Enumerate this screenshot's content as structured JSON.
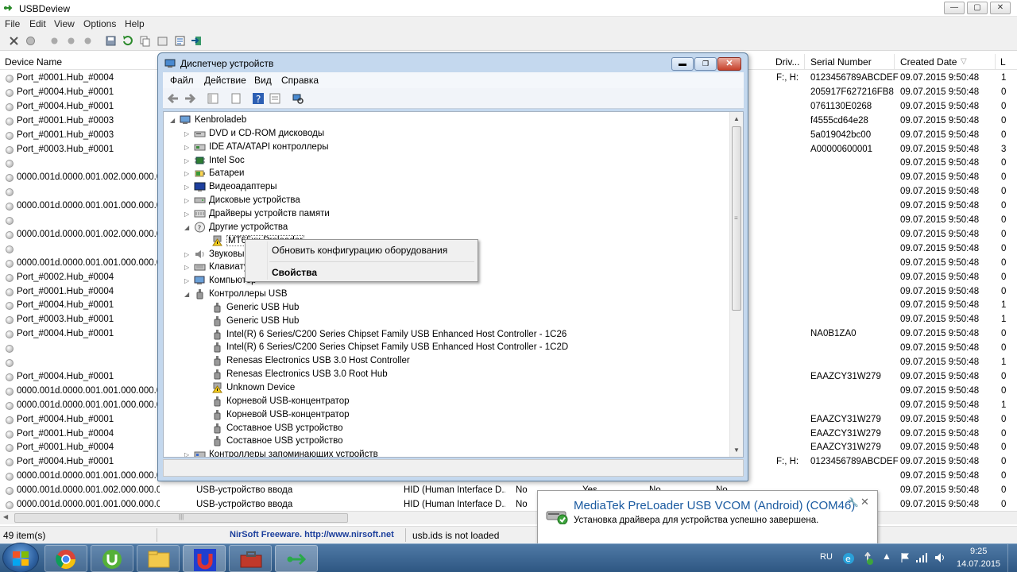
{
  "usbdeview": {
    "title": "USBDeview",
    "menu": [
      "File",
      "Edit",
      "View",
      "Options",
      "Help"
    ],
    "columns": {
      "device_name": "Device Name",
      "drive": "Driv...",
      "serial": "Serial Number",
      "created": "Created Date",
      "last": "L"
    },
    "rows": [
      [
        "Port_#0001.Hub_#0004",
        "",
        "",
        "",
        "",
        "",
        "",
        "F:, H:",
        "0123456789ABCDEF",
        "09.07.2015 9:50:48",
        "1"
      ],
      [
        "Port_#0004.Hub_#0001",
        "",
        "",
        "",
        "",
        "",
        "",
        "",
        "205917F627216FB8",
        "09.07.2015 9:50:48",
        "0"
      ],
      [
        "Port_#0004.Hub_#0001",
        "",
        "",
        "",
        "",
        "",
        "",
        "",
        "0761130E0268",
        "09.07.2015 9:50:48",
        "0"
      ],
      [
        "Port_#0001.Hub_#0003",
        "",
        "",
        "",
        "",
        "",
        "",
        "",
        "f4555cd64e28",
        "09.07.2015 9:50:48",
        "0"
      ],
      [
        "Port_#0001.Hub_#0003",
        "",
        "",
        "",
        "",
        "",
        "",
        "",
        "5a019042bc00",
        "09.07.2015 9:50:48",
        "0"
      ],
      [
        "Port_#0003.Hub_#0001",
        "",
        "",
        "",
        "",
        "",
        "",
        "",
        "A00000600001",
        "09.07.2015 9:50:48",
        "3"
      ],
      [
        "",
        "",
        "",
        "",
        "",
        "",
        "",
        "",
        "",
        "09.07.2015 9:50:48",
        "0"
      ],
      [
        "0000.001d.0000.001.002.000.000.000.000",
        "",
        "",
        "",
        "",
        "",
        "",
        "",
        "",
        "09.07.2015 9:50:48",
        "0"
      ],
      [
        "",
        "",
        "",
        "",
        "",
        "",
        "",
        "",
        "",
        "09.07.2015 9:50:48",
        "0"
      ],
      [
        "0000.001d.0000.001.001.000.000.000.000",
        "",
        "",
        "",
        "",
        "",
        "",
        "",
        "",
        "09.07.2015 9:50:48",
        "0"
      ],
      [
        "",
        "",
        "",
        "",
        "",
        "",
        "",
        "",
        "",
        "09.07.2015 9:50:48",
        "0"
      ],
      [
        "0000.001d.0000.001.002.000.000.000.000",
        "",
        "",
        "",
        "",
        "",
        "",
        "",
        "",
        "09.07.2015 9:50:48",
        "0"
      ],
      [
        "",
        "",
        "",
        "",
        "",
        "",
        "",
        "",
        "",
        "09.07.2015 9:50:48",
        "0"
      ],
      [
        "0000.001d.0000.001.001.000.000.000.000",
        "",
        "",
        "",
        "",
        "",
        "",
        "",
        "",
        "09.07.2015 9:50:48",
        "0"
      ],
      [
        "Port_#0002.Hub_#0004",
        "",
        "",
        "",
        "",
        "",
        "",
        "",
        "",
        "09.07.2015 9:50:48",
        "0"
      ],
      [
        "Port_#0001.Hub_#0004",
        "",
        "",
        "",
        "",
        "",
        "",
        "",
        "",
        "09.07.2015 9:50:48",
        "0"
      ],
      [
        "Port_#0004.Hub_#0001",
        "",
        "",
        "",
        "",
        "",
        "",
        "",
        "",
        "09.07.2015 9:50:48",
        "1"
      ],
      [
        "Port_#0003.Hub_#0001",
        "",
        "",
        "",
        "",
        "",
        "",
        "",
        "",
        "09.07.2015 9:50:48",
        "1"
      ],
      [
        "Port_#0004.Hub_#0001",
        "",
        "",
        "",
        "",
        "",
        "",
        "",
        "NA0B1ZA0",
        "09.07.2015 9:50:48",
        "0"
      ],
      [
        "",
        "",
        "",
        "",
        "",
        "",
        "",
        "",
        "",
        "09.07.2015 9:50:48",
        "0"
      ],
      [
        "",
        "",
        "",
        "",
        "",
        "",
        "",
        "",
        "",
        "09.07.2015 9:50:48",
        "1"
      ],
      [
        "Port_#0004.Hub_#0001",
        "",
        "",
        "",
        "",
        "",
        "",
        "",
        "EAAZCY31W279",
        "09.07.2015 9:50:48",
        "0"
      ],
      [
        "0000.001d.0000.001.001.000.000.000.000",
        "",
        "",
        "",
        "",
        "",
        "",
        "",
        "",
        "09.07.2015 9:50:48",
        "0"
      ],
      [
        "0000.001d.0000.001.001.000.000.000.000",
        "",
        "",
        "",
        "",
        "",
        "",
        "",
        "",
        "09.07.2015 9:50:48",
        "1"
      ],
      [
        "Port_#0004.Hub_#0001",
        "",
        "",
        "",
        "",
        "",
        "",
        "",
        "EAAZCY31W279",
        "09.07.2015 9:50:48",
        "0"
      ],
      [
        "Port_#0001.Hub_#0004",
        "",
        "",
        "",
        "",
        "",
        "",
        "",
        "EAAZCY31W279",
        "09.07.2015 9:50:48",
        "0"
      ],
      [
        "Port_#0001.Hub_#0004",
        "",
        "",
        "",
        "",
        "",
        "",
        "",
        "EAAZCY31W279",
        "09.07.2015 9:50:48",
        "0"
      ],
      [
        "Port_#0004.Hub_#0001",
        "",
        "",
        "",
        "",
        "",
        "",
        "F:, H:",
        "0123456789ABCDEF",
        "09.07.2015 9:50:48",
        "0"
      ],
      [
        "0000.001d.0000.001.001.000.000.000.000",
        "",
        "",
        "",
        "",
        "",
        "",
        "",
        "",
        "09.07.2015 9:50:48",
        "0"
      ],
      [
        "0000.001d.0000.001.002.000.000.000.000",
        "USB-устройство ввода",
        "HID (Human Interface D...",
        "No",
        "Yes",
        "No",
        "No",
        "",
        "",
        "09.07.2015 9:50:48",
        "0"
      ],
      [
        "0000.001d.0000.001.001.000.000.000.000",
        "USB-устройство ввода",
        "HID (Human Interface D...",
        "No",
        "",
        "",
        "",
        "",
        "",
        "09.07.2015 9:50:48",
        "0"
      ]
    ],
    "status": {
      "items": "49 item(s)",
      "nirsoft": "NirSoft Freeware.  http://www.nirsoft.net",
      "usbids": "usb.ids is not loaded"
    }
  },
  "device_manager": {
    "title": "Диспетчер устройств",
    "menu": [
      "Файл",
      "Действие",
      "Вид",
      "Справка"
    ],
    "tree": [
      {
        "text": "Kenbroladeb",
        "level": 0,
        "arrow": "open",
        "icon": "computer-icon"
      },
      {
        "text": "DVD и CD-ROM дисководы",
        "level": 1,
        "arrow": "closed",
        "icon": "dvd-icon"
      },
      {
        "text": "IDE ATA/ATAPI контроллеры",
        "level": 1,
        "arrow": "closed",
        "icon": "ide-icon"
      },
      {
        "text": "Intel Soc",
        "level": 1,
        "arrow": "closed",
        "icon": "chip-icon"
      },
      {
        "text": "Батареи",
        "level": 1,
        "arrow": "closed",
        "icon": "battery-icon"
      },
      {
        "text": "Видеоадаптеры",
        "level": 1,
        "arrow": "closed",
        "icon": "display-icon"
      },
      {
        "text": "Дисковые устройства",
        "level": 1,
        "arrow": "closed",
        "icon": "disk-icon"
      },
      {
        "text": "Драйверы устройств памяти",
        "level": 1,
        "arrow": "closed",
        "icon": "memory-icon"
      },
      {
        "text": "Другие устройства",
        "level": 1,
        "arrow": "open",
        "icon": "unknown-device-icon"
      },
      {
        "text": "MT65xx Preloader",
        "level": 2,
        "arrow": "",
        "icon": "warning-device-icon",
        "selected": true
      },
      {
        "text": "Звуковы",
        "level": 1,
        "arrow": "closed",
        "icon": "sound-icon"
      },
      {
        "text": "Клавиату",
        "level": 1,
        "arrow": "closed",
        "icon": "keyboard-icon"
      },
      {
        "text": "Компьютер",
        "level": 1,
        "arrow": "closed",
        "icon": "computer-icon"
      },
      {
        "text": "Контроллеры USB",
        "level": 1,
        "arrow": "open",
        "icon": "usb-icon"
      },
      {
        "text": "Generic USB Hub",
        "level": 2,
        "arrow": "",
        "icon": "usb-icon"
      },
      {
        "text": "Generic USB Hub",
        "level": 2,
        "arrow": "",
        "icon": "usb-icon"
      },
      {
        "text": "Intel(R) 6 Series/C200 Series Chipset Family USB Enhanced Host Controller - 1C26",
        "level": 2,
        "arrow": "",
        "icon": "usb-icon"
      },
      {
        "text": "Intel(R) 6 Series/C200 Series Chipset Family USB Enhanced Host Controller - 1C2D",
        "level": 2,
        "arrow": "",
        "icon": "usb-icon"
      },
      {
        "text": "Renesas Electronics USB 3.0 Host Controller",
        "level": 2,
        "arrow": "",
        "icon": "usb-icon"
      },
      {
        "text": "Renesas Electronics USB 3.0 Root Hub",
        "level": 2,
        "arrow": "",
        "icon": "usb-icon"
      },
      {
        "text": "Unknown Device",
        "level": 2,
        "arrow": "",
        "icon": "warning-device-icon"
      },
      {
        "text": "Корневой USB-концентратор",
        "level": 2,
        "arrow": "",
        "icon": "usb-icon"
      },
      {
        "text": "Корневой USB-концентратор",
        "level": 2,
        "arrow": "",
        "icon": "usb-icon"
      },
      {
        "text": "Составное USB устройство",
        "level": 2,
        "arrow": "",
        "icon": "usb-icon"
      },
      {
        "text": "Составное USB устройство",
        "level": 2,
        "arrow": "",
        "icon": "usb-icon"
      },
      {
        "text": "Контроллеры запоминающих устройств",
        "level": 1,
        "arrow": "closed",
        "icon": "storage-icon"
      }
    ],
    "context_menu": {
      "update": "Обновить конфигурацию оборудования",
      "properties": "Свойства"
    }
  },
  "notification": {
    "title": "MediaTek PreLoader USB VCOM (Android) (COM46)",
    "text": "Установка драйвера для устройства успешно завершена."
  },
  "taskbar": {
    "language": "RU",
    "time": "9:25",
    "date": "14.07.2015",
    "apps": [
      "chrome-icon",
      "utorrent-icon",
      "explorer-icon",
      "device-manager-icon",
      "toolbox-icon",
      "usbdeview-icon"
    ]
  }
}
